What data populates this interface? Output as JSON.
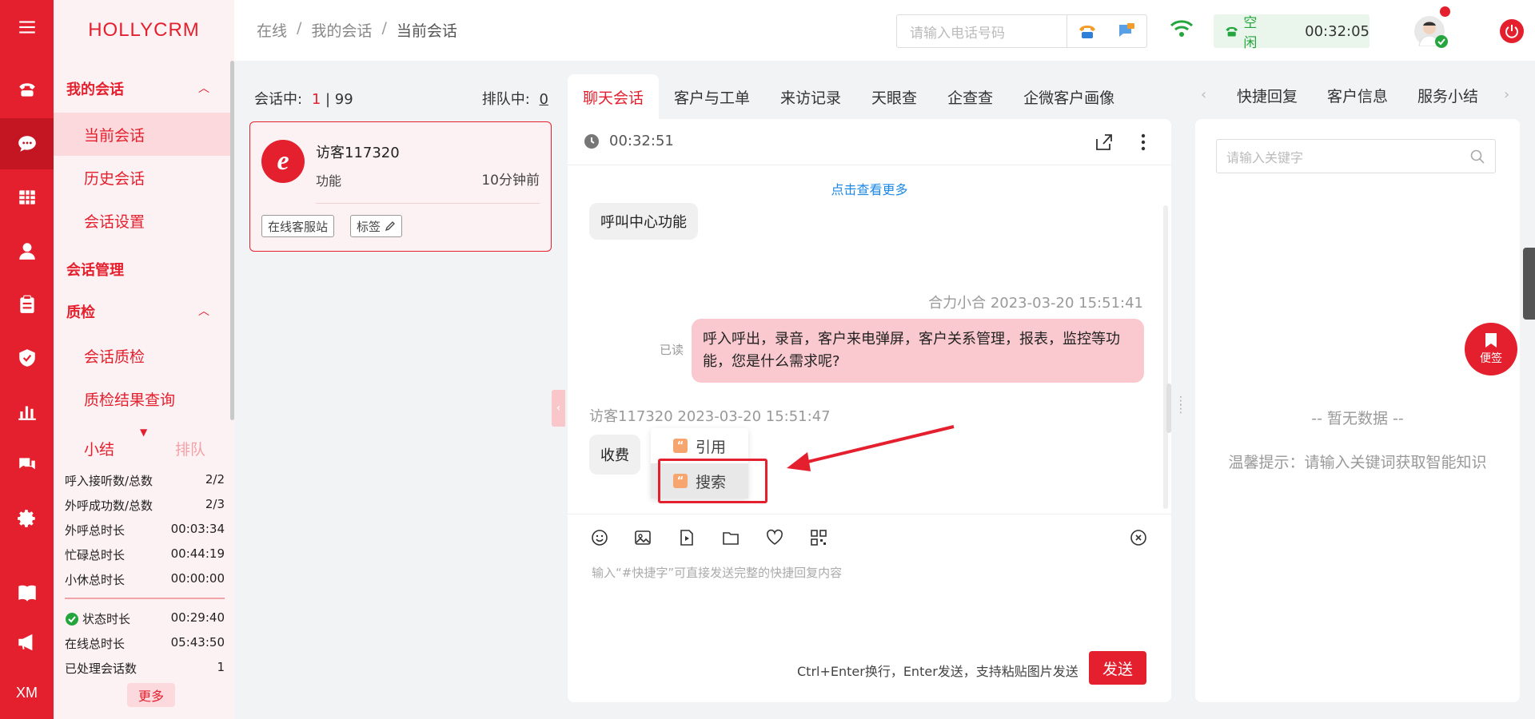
{
  "brand": "HOLLYCRM",
  "rail": {
    "bottom_text": "XM"
  },
  "nav": {
    "group1": "我的会话",
    "current": "当前会话",
    "history": "历史会话",
    "settings": "会话设置",
    "group2": "会话管理",
    "group3": "质检",
    "qc": "会话质检",
    "qc_query": "质检结果查询",
    "tab_summary": "小结",
    "tab_queue": "排队",
    "stats": [
      {
        "label": "呼入接听数/总数",
        "value": "2/2"
      },
      {
        "label": "外呼成功数/总数",
        "value": "2/3"
      },
      {
        "label": "外呼总时长",
        "value": "00:03:34"
      },
      {
        "label": "忙碌总时长",
        "value": "00:44:19"
      },
      {
        "label": "小休总时长",
        "value": "00:00:00"
      },
      {
        "label": "状态时长",
        "value": "00:29:40"
      },
      {
        "label": "在线总时长",
        "value": "05:43:50"
      },
      {
        "label": "已处理会话数",
        "value": "1"
      }
    ],
    "more": "更多"
  },
  "header": {
    "crumbs": [
      "在线",
      "我的会话",
      "当前会话"
    ],
    "phone_placeholder": "请输入电话号码",
    "status": "空闲",
    "timer": "00:32:05"
  },
  "sessions": {
    "active_label": "会话中:",
    "active_count": "1",
    "active_total": "| 99",
    "queue_label": "排队中:",
    "queue_count": "0",
    "card": {
      "logo": "e",
      "name": "访客117320",
      "desc": "功能",
      "time": "10分钟前",
      "tag1": "在线客服站",
      "tag2": "标签"
    }
  },
  "chat": {
    "tabs": [
      "聊天会话",
      "客户与工单",
      "来访记录",
      "天眼查",
      "企查查",
      "企微客户画像"
    ],
    "timer": "00:32:51",
    "see_more": "点击查看更多",
    "msg1": "呼叫中心功能",
    "agent_meta": "合力小合 2023-03-20 15:51:41",
    "read": "已读",
    "agent_msg": "呼入呼出，录音，客户来电弹屏，客户关系管理，报表，监控等功能，您是什么需求呢?",
    "visitor_meta": "访客117320 2023-03-20 15:51:47",
    "msg2": "收费",
    "menu_quote": "引用",
    "menu_search": "搜索",
    "input_hint": "输入“#快捷字”可直接发送完整的快捷回复内容",
    "send_hint": "Ctrl+Enter换行，Enter发送，支持粘贴图片发送",
    "send": "发送"
  },
  "right": {
    "tabs": [
      "快捷回复",
      "客户信息",
      "服务小结"
    ],
    "kw_placeholder": "请输入关键字",
    "no_data": "-- 暂无数据 --",
    "tip": "温馨提示：请输入关键词获取智能知识",
    "note": "便签"
  },
  "colors": {
    "brand": "#e4202e",
    "ok": "#24a53d",
    "link": "#1e88e5"
  }
}
